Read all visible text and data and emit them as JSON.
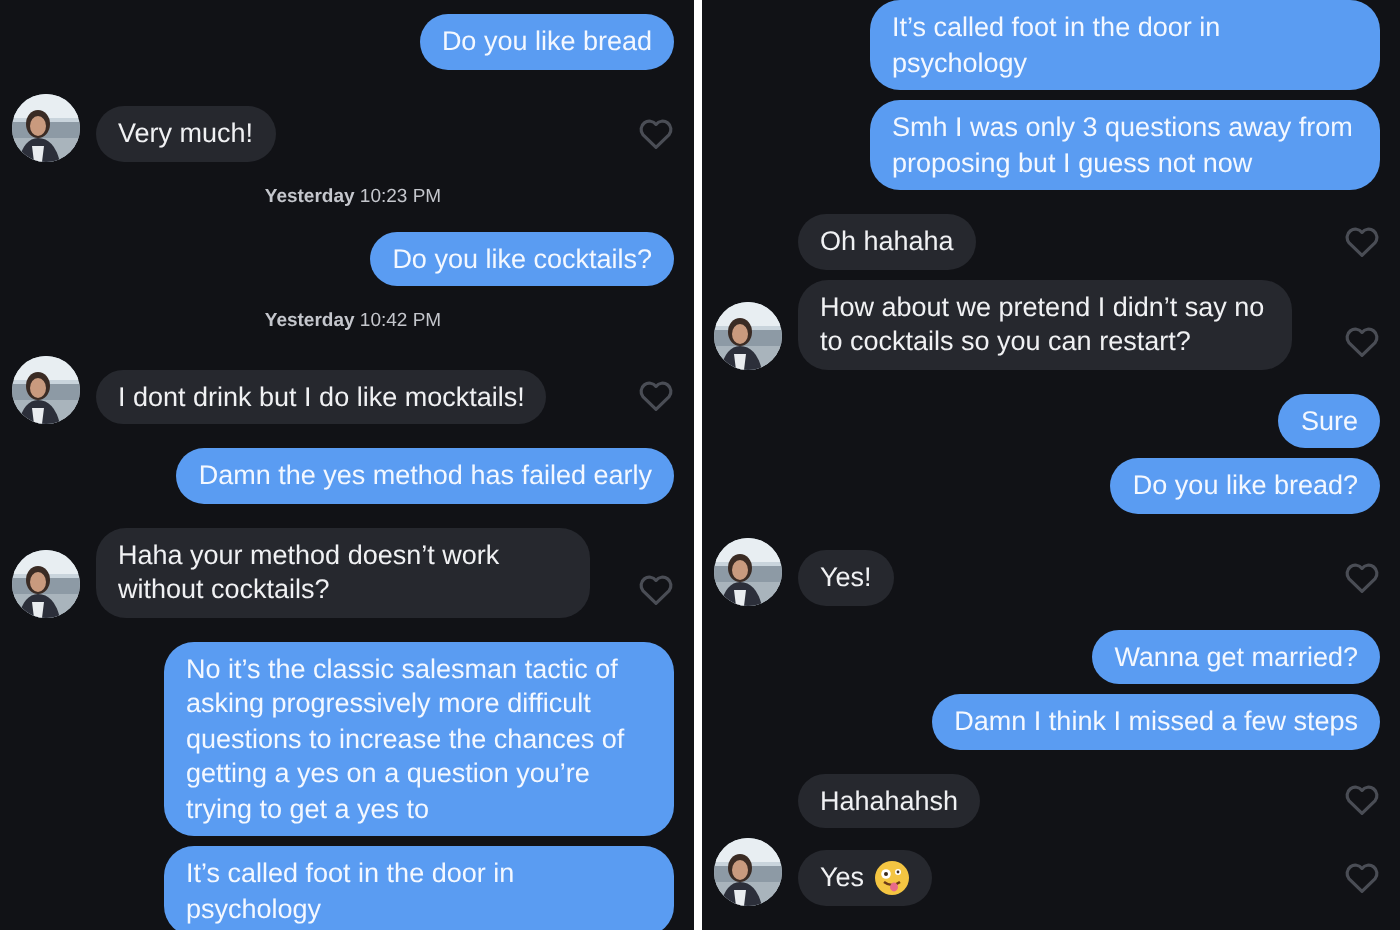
{
  "panels": [
    {
      "messages": [
        {
          "kind": "sent",
          "text": "Do you like bread"
        },
        {
          "kind": "received",
          "text": "Very much!",
          "avatar": true,
          "liked": false
        },
        {
          "kind": "timestamp",
          "day": "Yesterday",
          "time": "10:23 PM"
        },
        {
          "kind": "sent",
          "text": "Do you like cocktails?"
        },
        {
          "kind": "timestamp",
          "day": "Yesterday",
          "time": "10:42 PM"
        },
        {
          "kind": "received",
          "text": "I dont drink but I do like mocktails!",
          "avatar": true,
          "liked": false
        },
        {
          "kind": "sent",
          "text": "Damn the yes method has failed early"
        },
        {
          "kind": "received",
          "text": "Haha your method doesn’t work without cocktails?",
          "avatar": true,
          "liked": false
        },
        {
          "kind": "sent",
          "text": "No it’s the classic salesman tactic of asking progressively more difficult questions to increase the chances of getting a yes on a question you’re trying to get a yes to"
        },
        {
          "kind": "sent",
          "text": "It’s called foot in the door in psychology"
        }
      ]
    },
    {
      "messages": [
        {
          "kind": "sent",
          "text": "It’s called foot in the door in psychology"
        },
        {
          "kind": "sent",
          "text": "Smh I was only 3 questions away from proposing but I guess not now"
        },
        {
          "kind": "received",
          "text": "Oh hahaha",
          "avatar": false,
          "liked": false
        },
        {
          "kind": "received",
          "text": "How about we pretend I didn’t say no to cocktails so you can restart?",
          "avatar": true,
          "liked": false
        },
        {
          "kind": "sent",
          "text": "Sure"
        },
        {
          "kind": "sent",
          "text": "Do you like bread?"
        },
        {
          "kind": "received",
          "text": "Yes!",
          "avatar": true,
          "liked": false
        },
        {
          "kind": "sent",
          "text": "Wanna get married?"
        },
        {
          "kind": "sent",
          "text": "Damn I think I missed a few steps"
        },
        {
          "kind": "received",
          "text": "Hahahahsh",
          "avatar": false,
          "liked": false
        },
        {
          "kind": "received",
          "text": "Yes",
          "avatar": true,
          "liked": false,
          "emoji": true
        }
      ]
    }
  ]
}
